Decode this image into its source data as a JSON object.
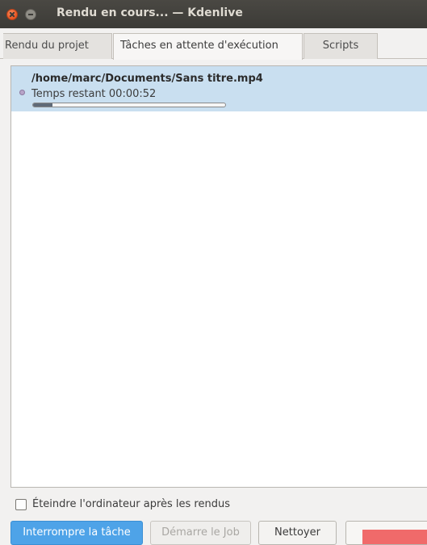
{
  "window": {
    "title": "Rendu en cours... — Kdenlive"
  },
  "tabs": [
    {
      "label": "Rendu du projet"
    },
    {
      "label": "Tâches en attente d'exécution"
    },
    {
      "label": "Scripts"
    }
  ],
  "jobs": [
    {
      "file": "/home/marc/Documents/Sans titre.mp4",
      "remaining": "Temps restant 00:00:52",
      "progress_percent": 10
    }
  ],
  "options": {
    "shutdown_label": "Éteindre l'ordinateur après les rendus",
    "shutdown_checked": false
  },
  "buttons": {
    "abort": "Interrompre la tâche",
    "start": "Démarre le Job",
    "clean": "Nettoyer"
  },
  "colors": {
    "accent": "#4ea3e8",
    "selection": "#c9dff0"
  },
  "icons": {
    "close": "close-icon",
    "minimize": "minimize-icon",
    "job_status": "job-status-icon"
  }
}
